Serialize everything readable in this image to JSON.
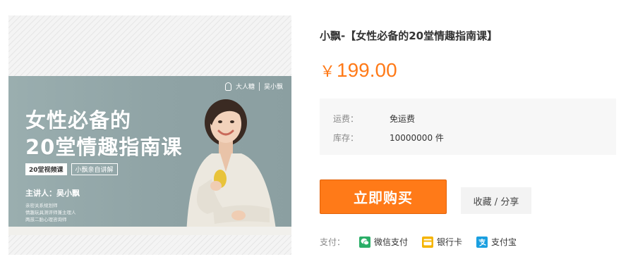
{
  "banner": {
    "brand_text": "大人糖",
    "brand_text2": "吴小飘",
    "title_line1": "女性必备的",
    "title_line2": "20堂情趣指南课",
    "tag1": "20堂视频课",
    "tag2": "小飘亲自讲解",
    "lecturer": "主讲人：吴小飘",
    "bio": [
      "亲密关系规划师",
      "情趣玩具测评师兼主理人",
      "两孩二胎心理咨询师"
    ]
  },
  "product": {
    "title": "小飘-【女性必备的20堂情趣指南课】",
    "currency": "￥",
    "price": "199.00"
  },
  "info": {
    "shipping_label": "运费：",
    "shipping_value": "免运费",
    "stock_label": "库存：",
    "stock_value": "10000000 件"
  },
  "actions": {
    "buy_label": "立即购买",
    "fav_share_label": "收藏 / 分享"
  },
  "payment": {
    "label": "支付：",
    "methods": [
      "微信支付",
      "银行卡",
      "支付宝"
    ]
  },
  "colors": {
    "accent": "#ff7a18",
    "wechat": "#2aae67",
    "card": "#f5b400",
    "alipay": "#1a9fe0"
  }
}
